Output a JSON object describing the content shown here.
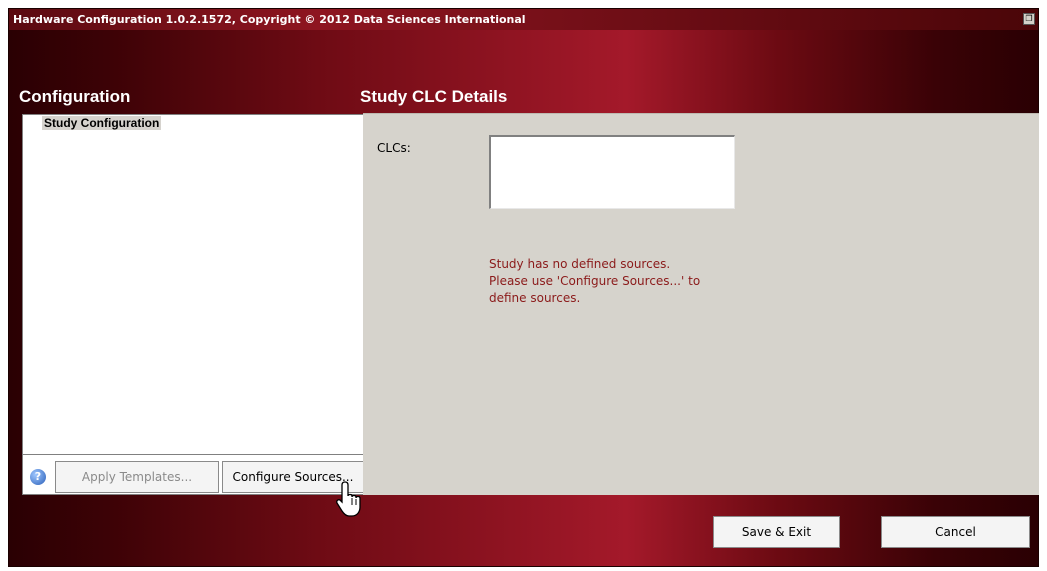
{
  "window": {
    "title": "Hardware Configuration 1.0.2.1572, Copyright © 2012 Data Sciences International",
    "title_button_icon": "restore-icon"
  },
  "left": {
    "heading": "Configuration",
    "tree_items": [
      "Study Configuration"
    ],
    "help_icon": "help-icon",
    "apply_templates_label": "Apply Templates...",
    "configure_sources_label": "Configure Sources..."
  },
  "right": {
    "heading": "Study CLC Details",
    "clcs_label": "CLCs:",
    "message_lines": [
      "Study has no defined sources.",
      "Please use 'Configure Sources...' to",
      "define sources."
    ]
  },
  "footer": {
    "save_exit_label": "Save & Exit",
    "cancel_label": "Cancel"
  },
  "colors": {
    "brand_red": "#a4192a",
    "message_text": "#8b1a1a",
    "panel_gray": "#d6d3cc"
  }
}
